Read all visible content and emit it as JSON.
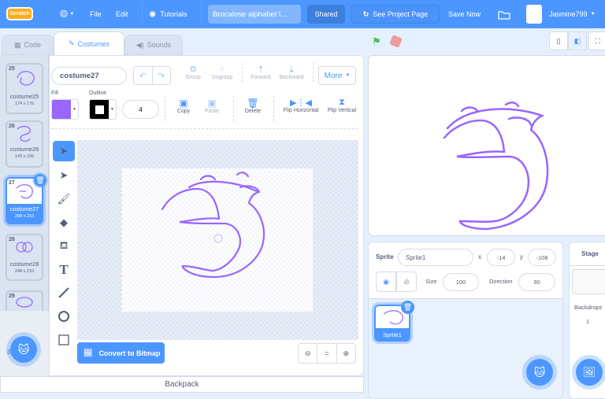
{
  "menubar": {
    "logo": "Scratch",
    "file": "File",
    "edit": "Edit",
    "tutorials": "Tutorials",
    "project_title": "Brocalose alphabet l...",
    "shared": "Shared",
    "see_project_page": "See Project Page",
    "save_now": "Save Now",
    "username": "Jasmine799"
  },
  "tabs": {
    "code": "Code",
    "costumes": "Costumes",
    "sounds": "Sounds"
  },
  "costumes": [
    {
      "num": "25",
      "name": "costume25",
      "size": "174 x 176"
    },
    {
      "num": "26",
      "name": "costume26",
      "size": "143 x 166"
    },
    {
      "num": "27",
      "name": "costume27",
      "size": "208 x 210",
      "selected": true
    },
    {
      "num": "28",
      "name": "costume28",
      "size": "248 x 210"
    },
    {
      "num": "29",
      "name": "",
      "size": ""
    }
  ],
  "partial_num": "3",
  "editor": {
    "costume_name": "costume27",
    "group": "Group",
    "ungroup": "Ungroup",
    "forward": "Forward",
    "backward": "Backward",
    "more": "More",
    "fill_label": "Fill",
    "outline_label": "Outline",
    "fill_color": "#9966ff",
    "outline_color": "#000000",
    "outline_width": "4",
    "copy": "Copy",
    "paste": "Paste",
    "delete": "Delete",
    "flip_h": "Flip Horizontal",
    "flip_v": "Flip Vertical",
    "convert": "Convert to Bitmap",
    "zoom_reset": "="
  },
  "sprite": {
    "label": "Sprite",
    "name": "Sprite1",
    "x_label": "x",
    "x": "-14",
    "y_label": "y",
    "y": "-108",
    "size_label": "Size",
    "size": "100",
    "direction_label": "Direction",
    "direction": "90",
    "tile_name": "Sprite1"
  },
  "stage_panel": {
    "title": "Stage",
    "backdrops_label": "Backdrops",
    "backdrops_count": "1"
  },
  "backpack": "Backpack",
  "colors": {
    "accent": "#4c97ff",
    "drawing": "#9966ff"
  }
}
